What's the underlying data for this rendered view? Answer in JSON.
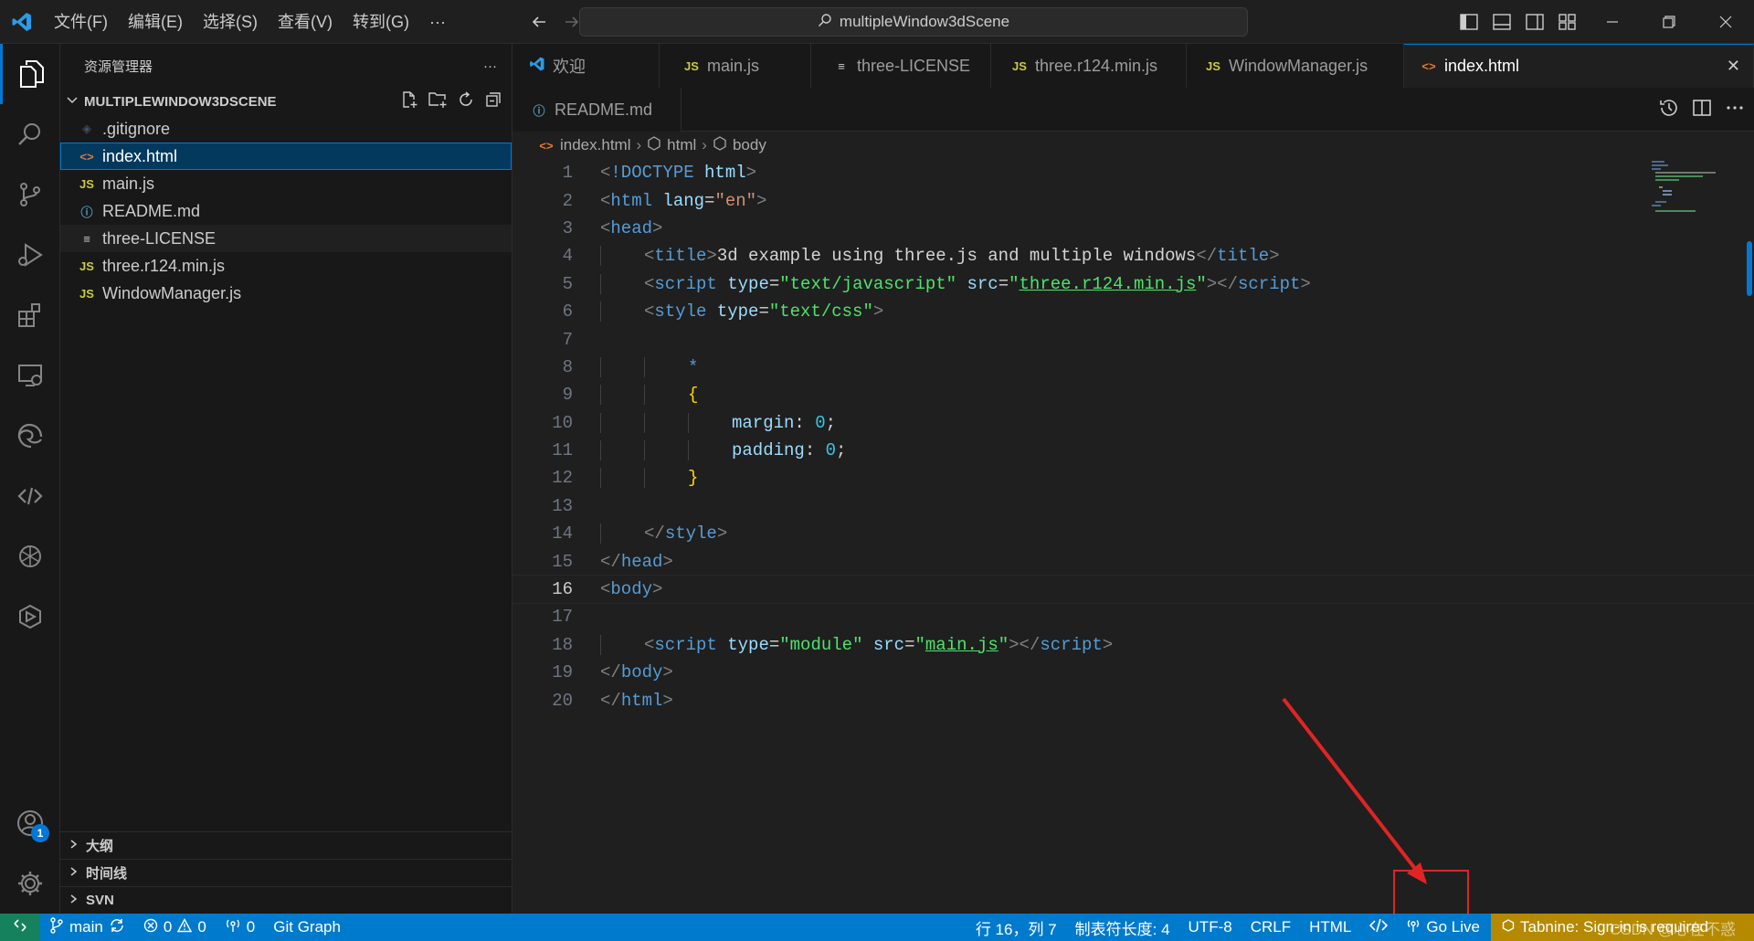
{
  "titlebar": {
    "menus": [
      "文件(F)",
      "编辑(E)",
      "选择(S)",
      "查看(V)",
      "转到(G)",
      "···"
    ],
    "search_text": "multipleWindow3dScene"
  },
  "activitybar": {
    "items": [
      "explorer-icon",
      "search-icon",
      "source-control-icon",
      "run-debug-icon",
      "extensions-icon",
      "remote-explorer-icon",
      "edge-devtools-icon",
      "live-share-icon",
      "chatgpt-icon",
      "codewhisperer-icon"
    ],
    "account_badge": "1"
  },
  "sidebar": {
    "title": "资源管理器",
    "more": "···",
    "folder": "MULTIPLEWINDOW3DSCENE",
    "files": [
      {
        "icon": "◈",
        "name": ".gitignore",
        "type": "git"
      },
      {
        "icon": "<>",
        "name": "index.html",
        "type": "html"
      },
      {
        "icon": "JS",
        "name": "main.js",
        "type": "js"
      },
      {
        "icon": "ⓘ",
        "name": "README.md",
        "type": "info"
      },
      {
        "icon": "≡",
        "name": "three-LICENSE",
        "type": "lic"
      },
      {
        "icon": "JS",
        "name": "three.r124.min.js",
        "type": "js"
      },
      {
        "icon": "JS",
        "name": "WindowManager.js",
        "type": "js"
      }
    ],
    "panels": [
      "大纲",
      "时间线",
      "SVN"
    ]
  },
  "tabs": {
    "row1": [
      {
        "icon": "vscode",
        "label": "欢迎"
      },
      {
        "icon": "JS",
        "label": "main.js"
      },
      {
        "icon": "≡",
        "label": "three-LICENSE"
      },
      {
        "icon": "JS",
        "label": "three.r124.min.js"
      },
      {
        "icon": "JS",
        "label": "WindowManager.js"
      },
      {
        "icon": "<>",
        "label": "index.html",
        "close": "✕"
      }
    ],
    "row2": [
      {
        "icon": "ⓘ",
        "label": "README.md"
      }
    ]
  },
  "breadcrumb": [
    "index.html",
    "html",
    "body"
  ],
  "code": {
    "current_line": 16,
    "lines": [
      {
        "n": "1",
        "indent": 0,
        "tokens": [
          [
            "t-punc",
            "<"
          ],
          [
            "t-tag",
            "!DOCTYPE "
          ],
          [
            "t-attr",
            "html"
          ],
          [
            "t-punc",
            ">"
          ]
        ]
      },
      {
        "n": "2",
        "indent": 0,
        "tokens": [
          [
            "t-punc",
            "<"
          ],
          [
            "t-tag",
            "html "
          ],
          [
            "t-attr",
            "lang"
          ],
          [
            "t-text",
            "="
          ],
          [
            "t-str",
            "\"en\""
          ],
          [
            "t-punc",
            ">"
          ]
        ]
      },
      {
        "n": "3",
        "indent": 0,
        "tokens": [
          [
            "t-punc",
            "<"
          ],
          [
            "t-tag",
            "head"
          ],
          [
            "t-punc",
            ">"
          ]
        ]
      },
      {
        "n": "4",
        "indent": 1,
        "tokens": [
          [
            "t-punc",
            "<"
          ],
          [
            "t-tag",
            "title"
          ],
          [
            "t-punc",
            ">"
          ],
          [
            "t-text",
            "3d example using three.js and multiple windows"
          ],
          [
            "t-punc",
            "</"
          ],
          [
            "t-tag",
            "title"
          ],
          [
            "t-punc",
            ">"
          ]
        ]
      },
      {
        "n": "5",
        "indent": 1,
        "tokens": [
          [
            "t-punc",
            "<"
          ],
          [
            "t-tag",
            "script "
          ],
          [
            "t-attr",
            "type"
          ],
          [
            "t-text",
            "="
          ],
          [
            "t-green",
            "\"text/javascript\""
          ],
          [
            "t-text",
            " "
          ],
          [
            "t-attr",
            "src"
          ],
          [
            "t-text",
            "="
          ],
          [
            "t-green",
            "\""
          ],
          [
            "t-green t-link",
            "three.r124.min.js"
          ],
          [
            "t-green",
            "\""
          ],
          [
            "t-punc",
            "></"
          ],
          [
            "t-tag",
            "script"
          ],
          [
            "t-punc",
            ">"
          ]
        ]
      },
      {
        "n": "6",
        "indent": 1,
        "tokens": [
          [
            "t-punc",
            "<"
          ],
          [
            "t-tag",
            "style "
          ],
          [
            "t-attr",
            "type"
          ],
          [
            "t-text",
            "="
          ],
          [
            "t-green",
            "\"text/css\""
          ],
          [
            "t-punc",
            ">"
          ]
        ]
      },
      {
        "n": "7",
        "indent": 0,
        "tokens": []
      },
      {
        "n": "8",
        "indent": 2,
        "tokens": [
          [
            "t-op",
            "*"
          ]
        ]
      },
      {
        "n": "9",
        "indent": 2,
        "tokens": [
          [
            "t-bracket",
            "{"
          ]
        ]
      },
      {
        "n": "10",
        "indent": 3,
        "tokens": [
          [
            "t-attr",
            "margin"
          ],
          [
            "t-text",
            ": "
          ],
          [
            "t-num",
            "0"
          ],
          [
            "t-text",
            ";"
          ]
        ]
      },
      {
        "n": "11",
        "indent": 3,
        "tokens": [
          [
            "t-attr",
            "padding"
          ],
          [
            "t-text",
            ": "
          ],
          [
            "t-num",
            "0"
          ],
          [
            "t-text",
            ";"
          ]
        ]
      },
      {
        "n": "12",
        "indent": 2,
        "tokens": [
          [
            "t-bracket",
            "}"
          ]
        ]
      },
      {
        "n": "13",
        "indent": 0,
        "tokens": []
      },
      {
        "n": "14",
        "indent": 1,
        "tokens": [
          [
            "t-punc",
            "</"
          ],
          [
            "t-tag",
            "style"
          ],
          [
            "t-punc",
            ">"
          ]
        ]
      },
      {
        "n": "15",
        "indent": 0,
        "tokens": [
          [
            "t-punc",
            "</"
          ],
          [
            "t-tag",
            "head"
          ],
          [
            "t-punc",
            ">"
          ]
        ]
      },
      {
        "n": "16",
        "indent": 0,
        "tokens": [
          [
            "t-punc",
            "<"
          ],
          [
            "t-tag",
            "body"
          ],
          [
            "t-punc",
            ">"
          ]
        ]
      },
      {
        "n": "17",
        "indent": 0,
        "tokens": []
      },
      {
        "n": "18",
        "indent": 1,
        "tokens": [
          [
            "t-punc",
            "<"
          ],
          [
            "t-tag",
            "script "
          ],
          [
            "t-attr",
            "type"
          ],
          [
            "t-text",
            "="
          ],
          [
            "t-green",
            "\"module\""
          ],
          [
            "t-text",
            " "
          ],
          [
            "t-attr",
            "src"
          ],
          [
            "t-text",
            "="
          ],
          [
            "t-green",
            "\""
          ],
          [
            "t-green t-link",
            "main.js"
          ],
          [
            "t-green",
            "\""
          ],
          [
            "t-punc",
            "></"
          ],
          [
            "t-tag",
            "script"
          ],
          [
            "t-punc",
            ">"
          ]
        ]
      },
      {
        "n": "19",
        "indent": 0,
        "tokens": [
          [
            "t-punc",
            "</"
          ],
          [
            "t-tag",
            "body"
          ],
          [
            "t-punc",
            ">"
          ]
        ]
      },
      {
        "n": "20",
        "indent": 0,
        "tokens": [
          [
            "t-punc",
            "</"
          ],
          [
            "t-tag",
            "html"
          ],
          [
            "t-punc",
            ">"
          ]
        ]
      }
    ]
  },
  "statusbar": {
    "branch": "main",
    "errors": "0",
    "warnings": "0",
    "ports": "0",
    "git_graph": "Git Graph",
    "position": "行 16，列 7",
    "tab_size": "制表符长度: 4",
    "encoding": "UTF-8",
    "eol": "CRLF",
    "language": "HTML",
    "go_live": "Go Live",
    "tabnine": "Tabnine: Sign-in is required",
    "watermark": "CSDN @心在不惑"
  },
  "colors": {
    "accent": "#0078d4",
    "statusbar": "#007acc",
    "annotation": "#e02424"
  }
}
